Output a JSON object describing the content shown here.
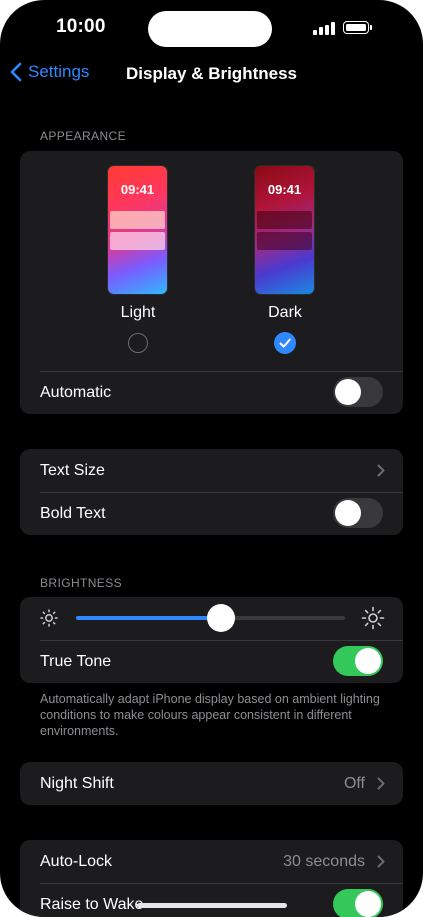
{
  "status_bar": {
    "time": "10:00"
  },
  "nav": {
    "back_label": "Settings",
    "title": "Display & Brightness"
  },
  "appearance": {
    "header": "APPEARANCE",
    "light": {
      "preview_time": "09:41",
      "label": "Light",
      "selected": false
    },
    "dark": {
      "preview_time": "09:41",
      "label": "Dark",
      "selected": true
    },
    "automatic_label": "Automatic",
    "automatic_on": false
  },
  "text": {
    "text_size_label": "Text Size",
    "bold_text_label": "Bold Text",
    "bold_text_on": false
  },
  "brightness": {
    "header": "BRIGHTNESS",
    "level": 0.54,
    "true_tone_label": "True Tone",
    "true_tone_on": true,
    "footer": "Automatically adapt iPhone display based on ambient lighting conditions to make colours appear consistent in different environments."
  },
  "night_shift": {
    "label": "Night Shift",
    "value": "Off"
  },
  "lock": {
    "auto_lock_label": "Auto-Lock",
    "auto_lock_value": "30 seconds",
    "raise_to_wake_label": "Raise to Wake",
    "raise_to_wake_on": true
  },
  "colors": {
    "accent": "#2f88ff",
    "toggle_on": "#34c759",
    "toggle_off": "#39393d",
    "group_bg": "#1c1c1e"
  }
}
